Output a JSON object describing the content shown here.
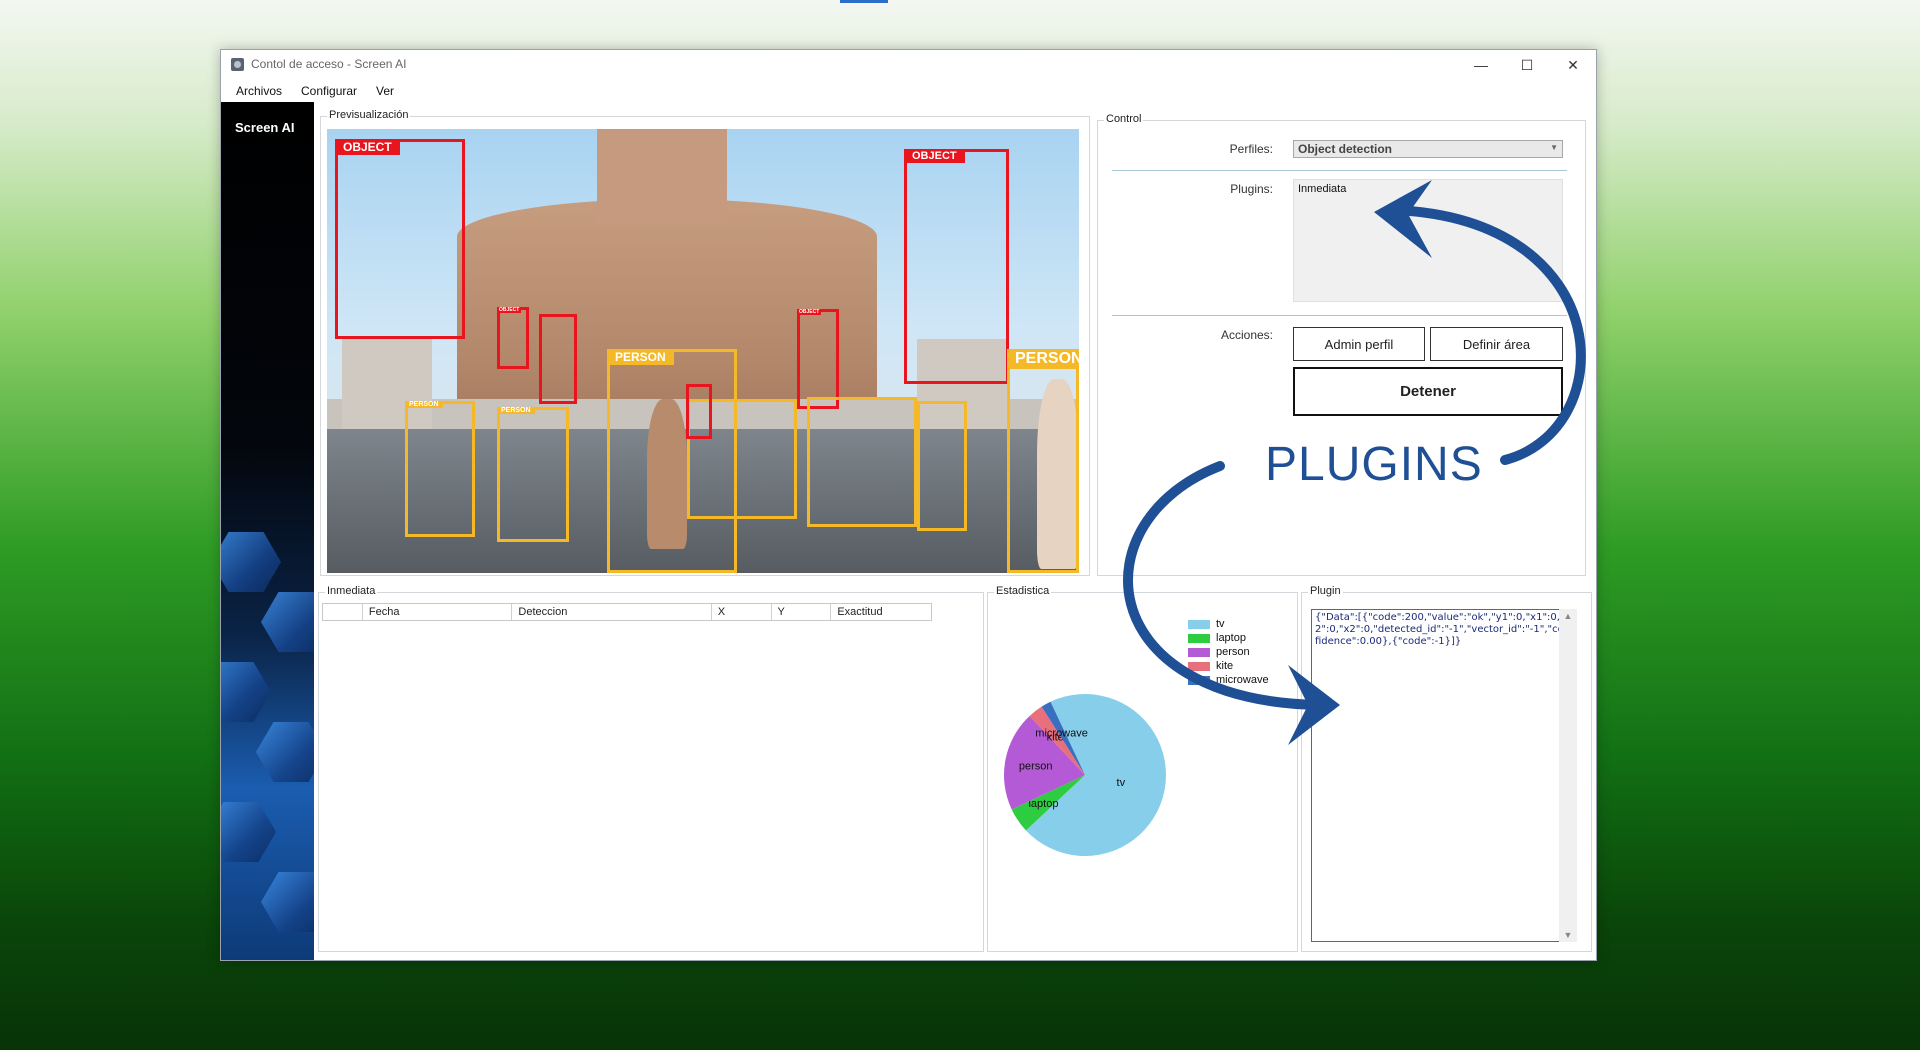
{
  "window": {
    "title": "Contol de acceso - Screen AI",
    "controls": {
      "minimize": "—",
      "maximize": "☐",
      "close": "✕"
    }
  },
  "menu": [
    "Archivos",
    "Configurar",
    "Ver"
  ],
  "sidebar": {
    "brand": "Screen AI"
  },
  "preview": {
    "label": "Previsualización",
    "detections": [
      {
        "label": "OBJECT",
        "kind": "object"
      },
      {
        "label": "OBJECT",
        "kind": "object"
      },
      {
        "label": "PERSON",
        "kind": "person"
      },
      {
        "label": "PERSON",
        "kind": "person"
      },
      {
        "label": "PERSON",
        "kind": "person"
      },
      {
        "label": "PERSON",
        "kind": "person"
      },
      {
        "label": "OBJECT",
        "kind": "object"
      },
      {
        "label": "OBJECT",
        "kind": "object"
      }
    ]
  },
  "control": {
    "label": "Control",
    "profiles_label": "Perfiles:",
    "profiles_value": "Object detection",
    "plugins_label": "Plugins:",
    "plugins_value": "Inmediata",
    "actions_label": "Acciones:",
    "admin_button": "Admin perfil",
    "area_button": "Definir área",
    "stop_button": "Detener"
  },
  "immediate": {
    "label": "Inmediata",
    "columns": [
      "",
      "Fecha",
      "Deteccion",
      "X",
      "Y",
      "Exactitud"
    ]
  },
  "stats": {
    "label": "Estadistica"
  },
  "chart_data": {
    "type": "pie",
    "categories": [
      "tv",
      "laptop",
      "person",
      "kite",
      "microwave"
    ],
    "values": [
      70,
      5,
      20,
      3,
      2
    ],
    "colors": [
      "#87ceeb",
      "#2ecc40",
      "#b45ad6",
      "#e8707c",
      "#3a6ebf"
    ],
    "legend_position": "top-right"
  },
  "plugin": {
    "label": "Plugin",
    "output": "{\"Data\":[{\"code\":200,\"value\":\"ok\",\"y1\":0,\"x1\":0,\"y2\":0,\"x2\":0,\"detected_id\":\"-1\",\"vector_id\":\"-1\",\"confidence\":0.00},{\"code\":-1}]}"
  },
  "annotation": {
    "text": "PLUGINS",
    "color": "#1f4f94"
  }
}
